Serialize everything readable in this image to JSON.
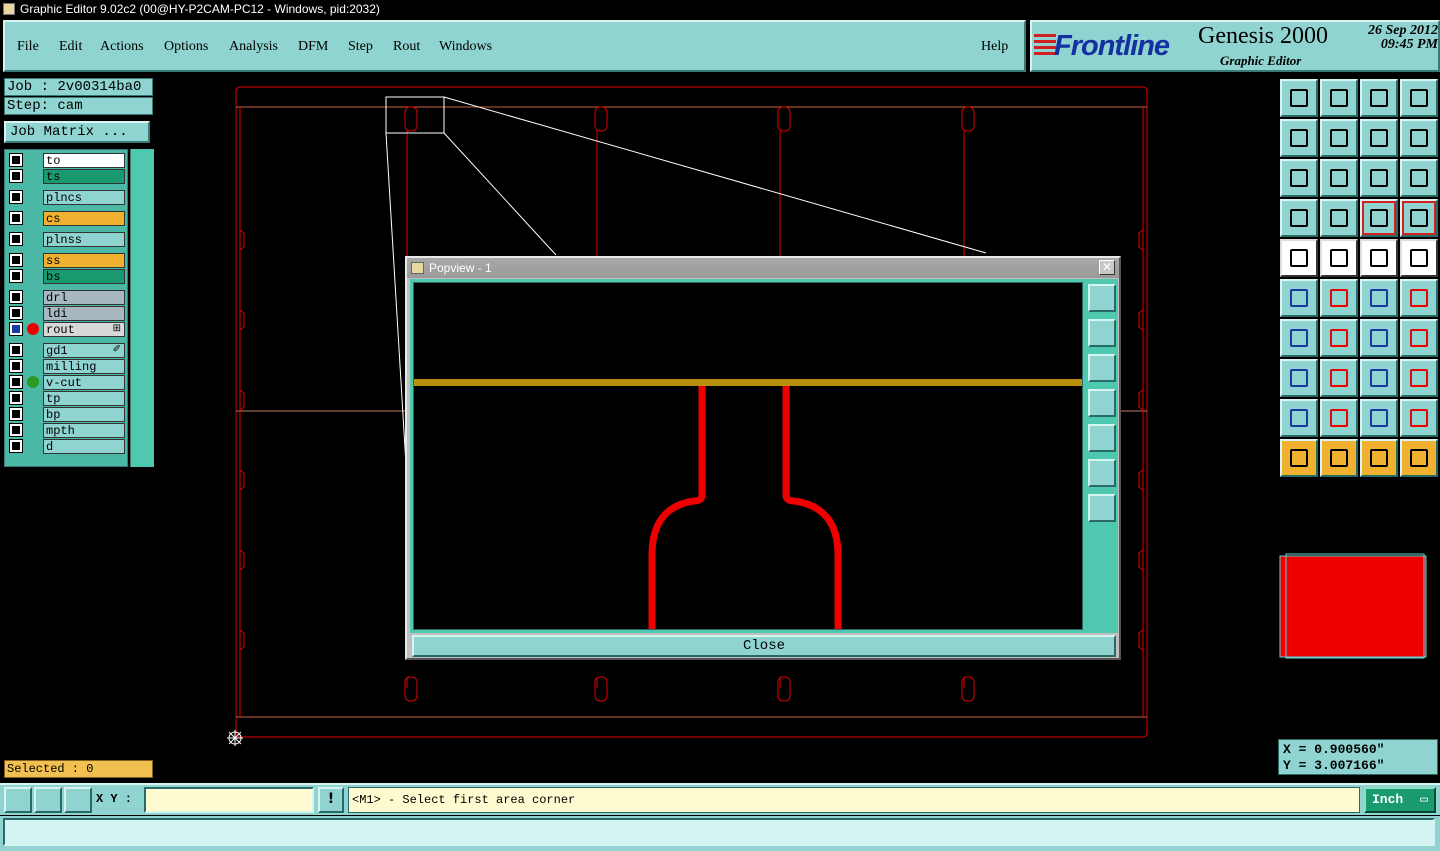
{
  "window": {
    "title": "Graphic Editor 9.02c2 (00@HY-P2CAM-PC12 - Windows, pid:2032)"
  },
  "menu": {
    "file": "File",
    "edit": "Edit",
    "actions": "Actions",
    "options": "Options",
    "analysis": "Analysis",
    "dfm": "DFM",
    "step": "Step",
    "rout": "Rout",
    "windows": "Windows",
    "help": "Help"
  },
  "brand": {
    "logo": "Frontline",
    "product": "Genesis 2000",
    "subtitle": "Graphic Editor",
    "date": "26 Sep 2012",
    "time": "09:45 PM"
  },
  "job": {
    "job_label": "Job : 2v00314ba0",
    "step_label": "Step: cam",
    "matrix_button": "Job Matrix ..."
  },
  "layers": [
    {
      "name": "to",
      "color": "#ffffff"
    },
    {
      "name": "ts",
      "color": "#1a9a70"
    },
    {
      "name": "plncs",
      "color": "#8fd4d0"
    },
    {
      "name": "cs",
      "color": "#f0b030"
    },
    {
      "name": "plnss",
      "color": "#8fd4d0"
    },
    {
      "name": "ss",
      "color": "#f0b030"
    },
    {
      "name": "bs",
      "color": "#1a9a70"
    },
    {
      "name": "drl",
      "color": "#a8b8c0"
    },
    {
      "name": "ldi",
      "color": "#a8b8c0"
    },
    {
      "name": "rout",
      "color": "#d8d8d8",
      "mark": "⊞"
    },
    {
      "name": "gd1",
      "color": "#8fd4d0",
      "mark": "✐"
    },
    {
      "name": "milling",
      "color": "#8fd4d0"
    },
    {
      "name": "v-cut",
      "color": "#8fd4d0"
    },
    {
      "name": "tp",
      "color": "#8fd4d0"
    },
    {
      "name": "bp",
      "color": "#8fd4d0"
    },
    {
      "name": "mpth",
      "color": "#8fd4d0"
    },
    {
      "name": "d",
      "color": "#8fd4d0"
    }
  ],
  "selected": "Selected : 0",
  "popview": {
    "title": "Popview - 1",
    "close_label": "Close"
  },
  "coords": {
    "x": "X = 0.900560\"",
    "y": "Y = 3.007166\""
  },
  "status": {
    "xy_label": "X Y :",
    "xy_value": "",
    "prompt": "<M1> - Select first area corner",
    "units": "Inch"
  },
  "toolbar_icons": [
    "zoom-home-icon",
    "zoom-home-icon",
    "home-icon",
    "window-icon",
    "pan-left-icon",
    "pan-right-icon",
    "swap-icon",
    "snake-icon",
    "zoom-fit-icon",
    "zoom-center-icon",
    "scale-1-2-icon",
    "question-icon",
    "measure-settings-icon",
    "grid-icon",
    "snap-red-icon",
    "snap-red-icon",
    "pad-add-icon",
    "line-add-icon",
    "ruler-icon",
    "circle-icon",
    "net-icon",
    "cross-icon",
    "move-point-icon",
    "move-point-icon",
    "angle-icon",
    "line-icon",
    "arc-icon",
    "flip-icon",
    "pad-move-icon",
    "red-line-icon",
    "dimension-icon",
    "blob-icon",
    "triangle-icon",
    "triangle-icon",
    "triangle-icon",
    "triangle-icon",
    "select-cursor-icon",
    "select-cursor-icon",
    "select-cursor-icon",
    "route-cursor-icon"
  ]
}
